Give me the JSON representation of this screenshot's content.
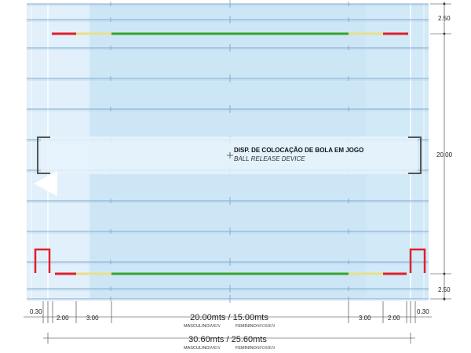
{
  "colors": {
    "water": "#cde6f6",
    "water_light": "#e4f1fa",
    "lane_line": "#7fa9cf",
    "goal": "#e0202a",
    "line_red": "#e0202a",
    "line_yellow": "#eadf8a",
    "line_green": "#34a52c",
    "dim_line": "#333333"
  },
  "dimensions": {
    "right_top": "2.50",
    "right_middle": "20.00",
    "right_bottom": "2.50",
    "bottom_left_1": "0.30",
    "bottom_left_2": "2.00",
    "bottom_left_3": "3.00",
    "bottom_right_3": "3.00",
    "bottom_right_2": "2.00",
    "bottom_right_1": "0.30",
    "field_length": "20.00mts / 15.00mts",
    "pool_length": "30.60mts / 25.60mts"
  },
  "labels": {
    "men_prefix": "MASCULINO/",
    "men_suffix": "MEN",
    "women_prefix": "FEMININO/",
    "women_suffix": "WOMEN"
  },
  "device": {
    "title": "DISP. DE COLOCAÇÃO DE BOLA EM JOGO",
    "subtitle": "BALL RELEASE DEVICE"
  }
}
